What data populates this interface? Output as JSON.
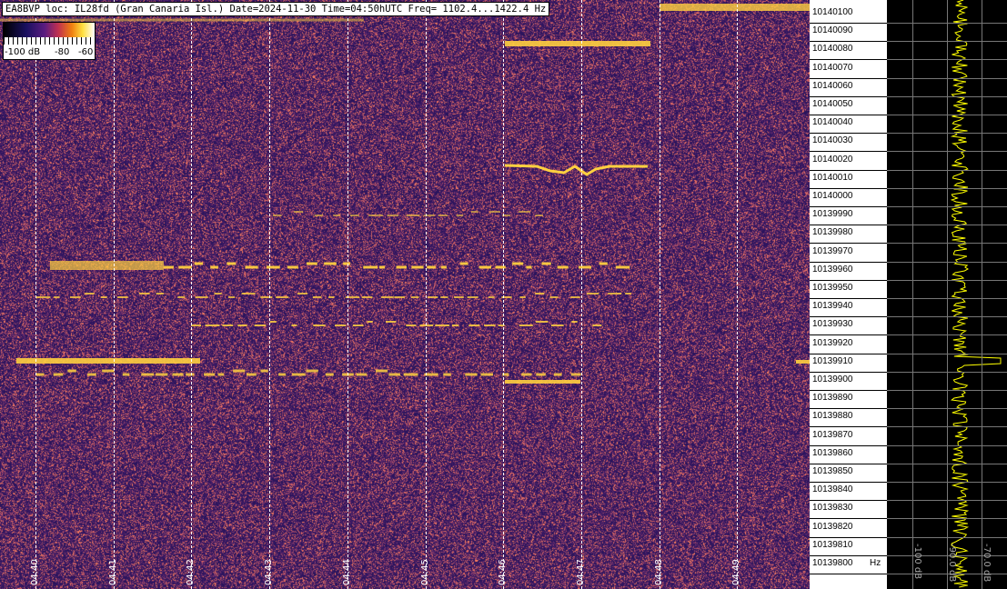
{
  "header": {
    "title": "EA8BVP loc: IL28fd (Gran Canaria Isl.) Date=2024-11-30 Time=04:50hUTC Freq= 1102.4...1422.4 Hz"
  },
  "colorbar": {
    "labels": [
      "-100 dB",
      "-80",
      "-60"
    ]
  },
  "chart_data": {
    "type": "heatmap",
    "title": "EA8BVP loc: IL28fd (Gran Canaria Isl.) Date=2024-11-30 Time=04:50hUTC Freq= 1102.4...1422.4 Hz",
    "x_ticks": [
      "04:40",
      "04:41",
      "04:42",
      "04:43",
      "04:44",
      "04:45",
      "04:46",
      "04:47",
      "04:48",
      "04:49"
    ],
    "y_ticks": [
      "10140100",
      "10140090",
      "10140080",
      "10140070",
      "10140060",
      "10140050",
      "10140040",
      "10140030",
      "10140020",
      "10140010",
      "10140000",
      "10139990",
      "10139980",
      "10139970",
      "10139960",
      "10139950",
      "10139940",
      "10139930",
      "10139920",
      "10139910",
      "10139900",
      "10139890",
      "10139880",
      "10139870",
      "10139860",
      "10139850",
      "10139840",
      "10139830",
      "10139820",
      "10139810",
      "10139800"
    ],
    "y_unit": "Hz",
    "color_range_db": [
      -100,
      -60
    ],
    "spectrum_ticks": [
      "-100 dB",
      "-90.0 dB",
      "-70.0 dB"
    ],
    "colors": {
      "background": "#2a1a6a",
      "signal": "#ffd040",
      "trace": "#ffff00"
    }
  }
}
